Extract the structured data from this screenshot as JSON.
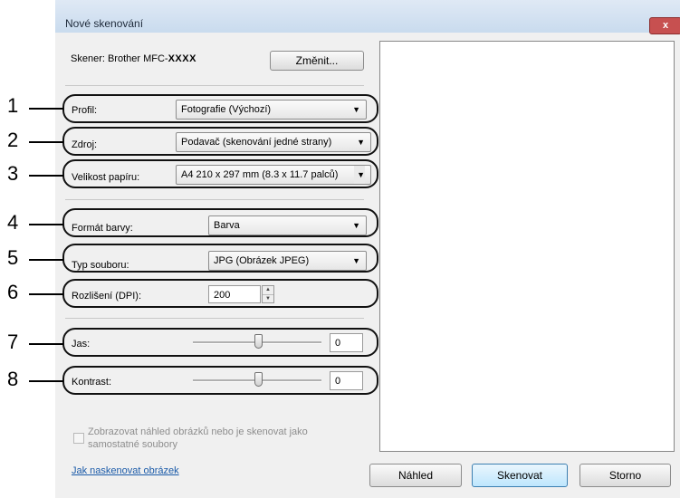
{
  "window": {
    "title": "Nové skenování",
    "close_glyph": "x"
  },
  "scanner": {
    "label": "Skener: Brother MFC-",
    "model": "XXXX",
    "change_button": "Změnit..."
  },
  "profile": {
    "label": "Profil:",
    "value": "Fotografie (Výchozí)"
  },
  "source": {
    "label": "Zdroj:",
    "value": "Podavač (skenování jedné strany)"
  },
  "paper": {
    "label": "Velikost papíru:",
    "value": "A4 210 x 297 mm (8.3 x 11.7 palců)"
  },
  "color_format": {
    "label": "Formát barvy:",
    "value": "Barva"
  },
  "file_type": {
    "label": "Typ souboru:",
    "value": "JPG (Obrázek JPEG)"
  },
  "resolution": {
    "label": "Rozlišení (DPI):",
    "value": "200"
  },
  "brightness": {
    "label": "Jas:",
    "value": "0"
  },
  "contrast": {
    "label": "Kontrast:",
    "value": "0"
  },
  "preview_option": {
    "label_line1": "Zobrazovat náhled obrázků nebo je skenovat jako",
    "label_line2": "samostatné soubory"
  },
  "help_link": "Jak naskenovat obrázek",
  "buttons": {
    "preview": "Náhled",
    "scan": "Skenovat",
    "cancel": "Storno"
  },
  "callouts": [
    "1",
    "2",
    "3",
    "4",
    "5",
    "6",
    "7",
    "8"
  ]
}
